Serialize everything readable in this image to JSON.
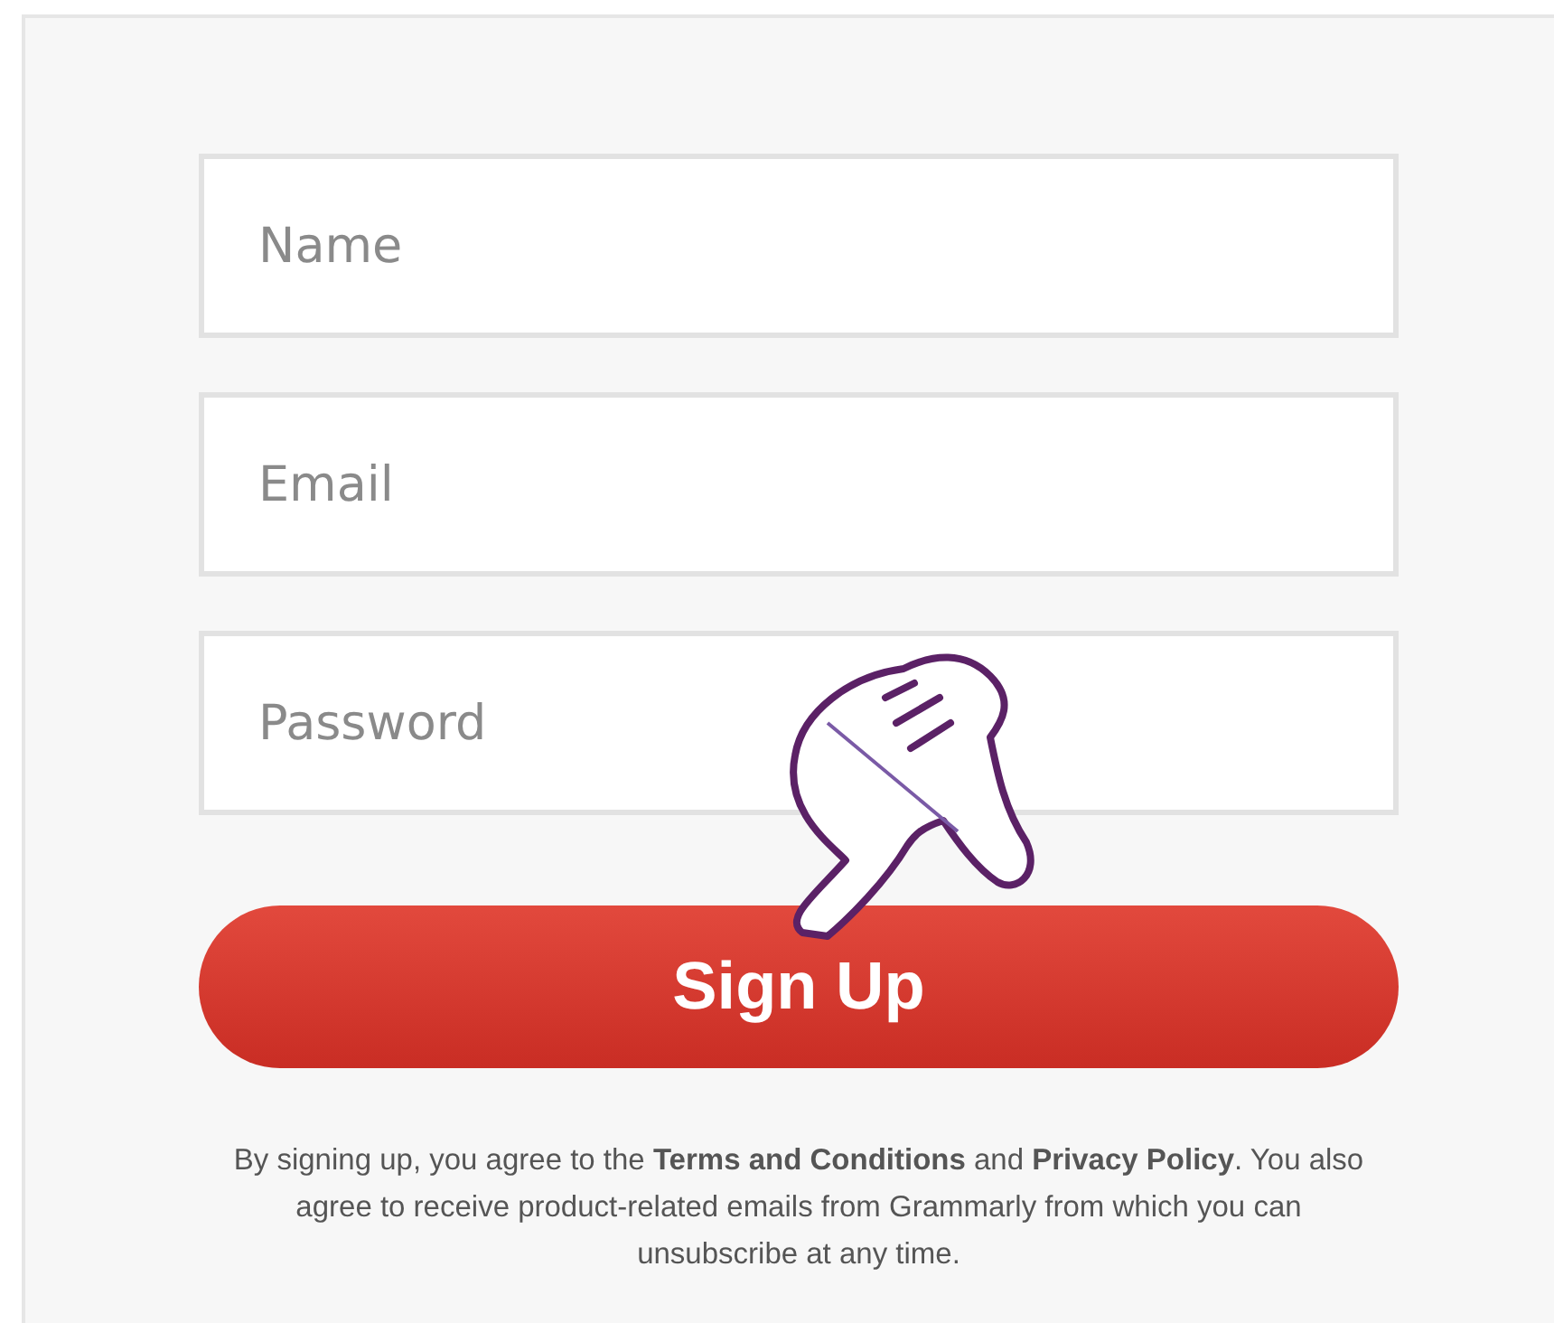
{
  "form": {
    "fields": [
      {
        "placeholder": "Name"
      },
      {
        "placeholder": "Email"
      },
      {
        "placeholder": "Password"
      }
    ],
    "submit": {
      "label": "Sign Up"
    },
    "legal": "By signing up, you agree to the **Terms and Conditions** and **Privacy Policy**. You also agree to receive product-related emails from Grammarly from which you can unsubscribe at any time."
  }
}
